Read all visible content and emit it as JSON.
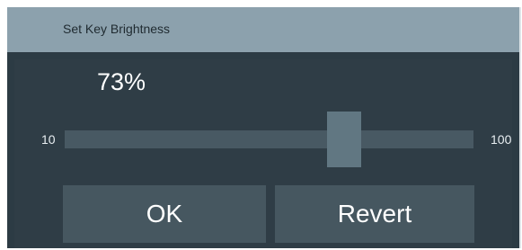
{
  "dialog": {
    "title": "Set Key Brightness",
    "value_display": "73%",
    "slider": {
      "min_label": "10",
      "max_label": "100",
      "value_percent": 73
    },
    "buttons": {
      "ok": "OK",
      "revert": "Revert"
    }
  },
  "colors": {
    "title_bar": "#8ca1ad",
    "panel": "#2c3b44",
    "track": "#485963",
    "thumb": "#617782",
    "button": "#465760"
  }
}
